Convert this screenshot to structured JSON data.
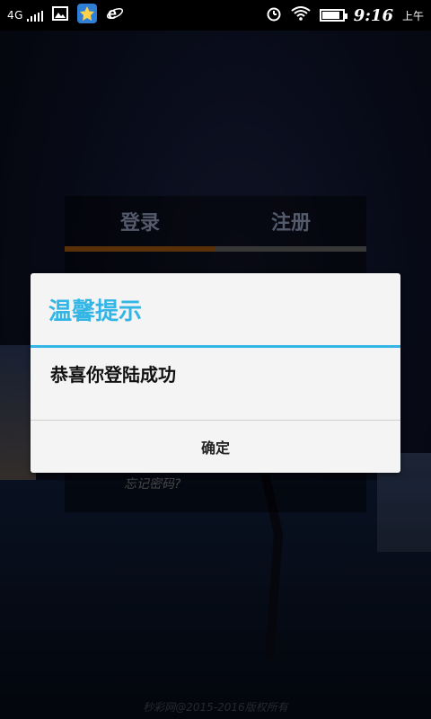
{
  "status_bar": {
    "signal": "4G",
    "time": "9:16",
    "ampm": "上午",
    "battery_level": 0.85,
    "icons": [
      "signal-icon",
      "gallery-icon",
      "favorite-app-icon",
      "browser-icon",
      "alarm-icon",
      "wifi-icon",
      "battery-icon"
    ]
  },
  "login_panel": {
    "tab_login": "登录",
    "tab_register": "注册",
    "forgot_password": "忘记密码?"
  },
  "footer": {
    "copyright": "秒彩网@2015-2016版权所有"
  },
  "dialog": {
    "title": "温馨提示",
    "message": "恭喜你登陆成功",
    "confirm_label": "确定",
    "accent_color": "#33b5e5"
  }
}
